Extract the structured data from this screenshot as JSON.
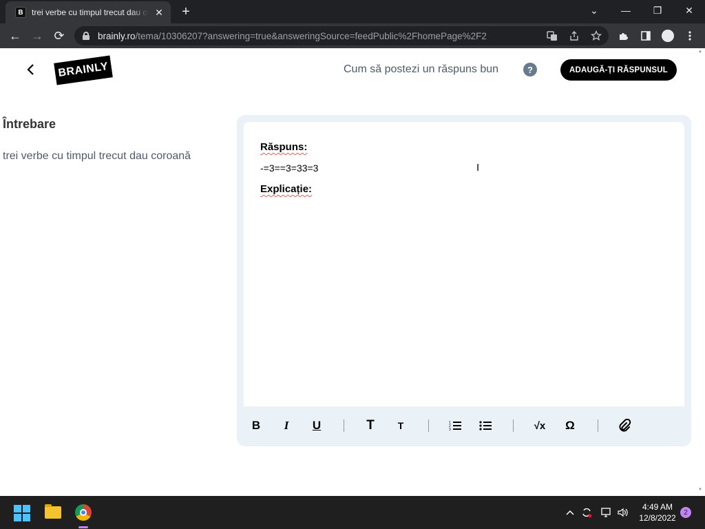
{
  "browser": {
    "tab_title": "trei verbe cu timpul trecut dau coroană",
    "tab_favicon": "B",
    "new_tab_icon": "+",
    "url_host": "brainly.ro",
    "url_path": "/tema/10306207?answering=true&answeringSource=feedPublic%2FhomePage%2F2",
    "controls": {
      "back": "←",
      "forward": "→",
      "reload": "⟳",
      "close_tab": "✕",
      "minimize": "—",
      "restore": "❐",
      "close_window": "✕",
      "tab_search": "⌄"
    }
  },
  "header": {
    "back_icon": "chevron-left-icon",
    "logo_text": "BRAINLY",
    "howto_text": "Cum să postezi un răspuns bun",
    "help_symbol": "?",
    "add_answer_label": "ADAUGĂ-ȚI RĂSPUNSUL"
  },
  "question": {
    "heading": "Întrebare",
    "text": "trei verbe cu timpul trecut dau coroană"
  },
  "editor": {
    "answer_label": "Răspuns:",
    "answer_text": "-=3==3=33=3",
    "explanation_label": "Explicație:",
    "toolbar": {
      "bold": "B",
      "italic": "I",
      "underline": "U",
      "heading_large": "T",
      "heading_small": "T",
      "ordered_list": "☰",
      "bullet_list": "☰",
      "math": "√x",
      "special_chars": "Ω",
      "attach": "⌀"
    }
  },
  "taskbar": {
    "time": "4:49 AM",
    "date": "12/8/2022",
    "notification_count": "2"
  }
}
